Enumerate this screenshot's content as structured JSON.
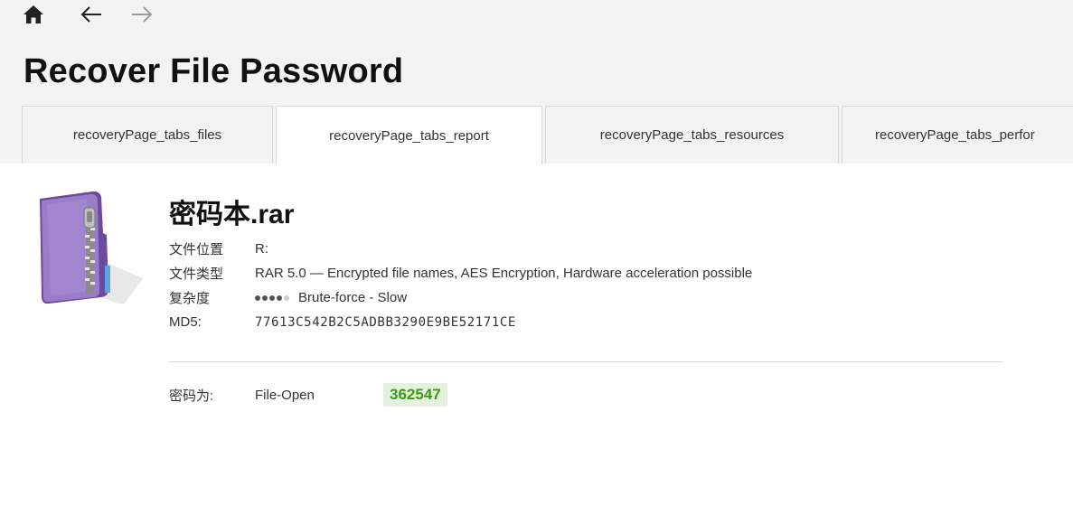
{
  "header": {
    "title": "Recover File Password"
  },
  "nav": {
    "home_icon": "home-icon",
    "back_icon": "arrow-left-icon",
    "forward_icon": "arrow-right-icon"
  },
  "tabs": [
    {
      "label": "recoveryPage_tabs_files",
      "active": false
    },
    {
      "label": "recoveryPage_tabs_report",
      "active": true
    },
    {
      "label": "recoveryPage_tabs_resources",
      "active": false
    },
    {
      "label": "recoveryPage_tabs_perfor",
      "active": false
    }
  ],
  "file": {
    "icon": "rar-archive-icon",
    "name": "密码本.rar",
    "location_label": "文件位置",
    "location": "R:",
    "type_label": "文件类型",
    "type": "RAR 5.0 — Encrypted file names, AES Encryption, Hardware acceleration possible",
    "complexity_label": "复杂度",
    "complexity_level": 4,
    "complexity_max": 5,
    "complexity": "Brute-force - Slow",
    "md5_label": "MD5:",
    "md5": "77613C542B2C5ADBB3290E9BE52171CE"
  },
  "result": {
    "label": "密码为:",
    "type": "File-Open",
    "password": "362547"
  },
  "colors": {
    "password_bg": "#e4f1de",
    "password_text": "#3d9a17",
    "icon_purple": "#8f6fc0"
  }
}
